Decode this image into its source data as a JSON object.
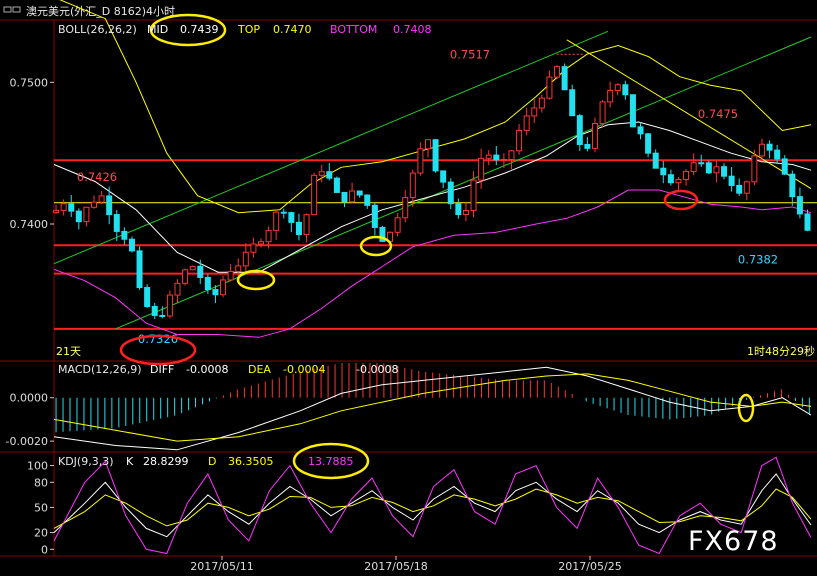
{
  "window": {
    "title": "澳元美元(外汇_D 8162)4小时"
  },
  "colors": {
    "background": "#000000",
    "up_candle": "#ff3333",
    "down_candle": "#22e0f0",
    "mid": "#ffffff",
    "top_band": "#ffff00",
    "bottom_band": "#ff33ff",
    "channel": "#22cc22",
    "hline": "#ff2020",
    "annotation": "#ffee00",
    "label_red": "#ff4b4b",
    "label_cyan": "#33d6ff",
    "bar_text": "#ffff66"
  },
  "boll": {
    "header": "BOLL(26,26,2)",
    "mid_label": "MID",
    "mid_value": "0.7439",
    "top_label": "TOP",
    "top_value": "0.7470",
    "bottom_label": "BOTTOM",
    "bottom_value": "0.7408"
  },
  "price_axis": {
    "ticks": [
      "0.7500",
      "0.7400"
    ],
    "tick_values": [
      0.75,
      0.74
    ],
    "ymin": 0.7316,
    "ymax": 0.7544
  },
  "price_labels": [
    {
      "text": "0.7426",
      "color": "red"
    },
    {
      "text": "0.7326",
      "color": "cyan"
    },
    {
      "text": "0.7517",
      "color": "red"
    },
    {
      "text": "0.7475",
      "color": "red"
    },
    {
      "text": "0.7382",
      "color": "cyan"
    }
  ],
  "status": {
    "left": "21天",
    "right": "1时48分29秒"
  },
  "macd": {
    "header": "MACD(12,26,9)",
    "diff_label": "DIFF",
    "diff_value": "-0.0008",
    "dea_label": "DEA",
    "dea_value": "-0.0004",
    "macd_value": "-0.0008",
    "ticks": [
      "0.0000",
      "-0.0020"
    ],
    "tick_values": [
      0.0,
      -0.002
    ],
    "ymin": -0.0025,
    "ymax": 0.0016
  },
  "kdj": {
    "header": "KDJ(9,3,3)",
    "k_label": "K",
    "k_value": "28.8299",
    "d_label": "D",
    "d_value": "36.3505",
    "j_value": "13.7885",
    "ticks": [
      "100",
      "80",
      "50",
      "20",
      "0"
    ],
    "tick_values": [
      100,
      80,
      50,
      20,
      0
    ],
    "ymin": -8,
    "ymax": 115
  },
  "x_axis": {
    "dates": [
      "2017/05/11",
      "2017/05/18",
      "2017/05/25"
    ]
  },
  "watermark": "FX678",
  "chart_data": {
    "type": "candlestick",
    "symbol": "澳元美元",
    "horizontal_levels": [
      0.7445,
      0.7415,
      0.7385,
      0.7365,
      0.7326
    ],
    "annotated_points": [
      {
        "label": "0.7426",
        "value": 0.7426
      },
      {
        "label": "0.7326",
        "value": 0.7326
      },
      {
        "label": "0.7517",
        "value": 0.7517
      },
      {
        "label": "0.7475",
        "value": 0.7475
      },
      {
        "label": "0.7382",
        "value": 0.7382
      }
    ],
    "close_path": [
      [
        0,
        0.7408
      ],
      [
        6,
        0.7418
      ],
      [
        12,
        0.7402
      ],
      [
        18,
        0.7416
      ],
      [
        24,
        0.742
      ],
      [
        30,
        0.7398
      ],
      [
        35,
        0.739
      ],
      [
        38,
        0.738
      ],
      [
        42,
        0.735
      ],
      [
        46,
        0.734
      ],
      [
        50,
        0.7332
      ],
      [
        54,
        0.734
      ],
      [
        58,
        0.7352
      ],
      [
        62,
        0.7362
      ],
      [
        66,
        0.7372
      ],
      [
        70,
        0.7368
      ],
      [
        74,
        0.7352
      ],
      [
        78,
        0.7348
      ],
      [
        82,
        0.736
      ],
      [
        86,
        0.7368
      ],
      [
        90,
        0.7372
      ],
      [
        94,
        0.7378
      ],
      [
        98,
        0.7386
      ],
      [
        102,
        0.7392
      ],
      [
        106,
        0.74
      ],
      [
        110,
        0.7412
      ],
      [
        114,
        0.741
      ],
      [
        118,
        0.739
      ],
      [
        122,
        0.7398
      ],
      [
        126,
        0.743
      ],
      [
        130,
        0.744
      ],
      [
        134,
        0.7432
      ],
      [
        138,
        0.742
      ],
      [
        142,
        0.7418
      ],
      [
        146,
        0.7422
      ],
      [
        150,
        0.742
      ],
      [
        154,
        0.741
      ],
      [
        158,
        0.7392
      ],
      [
        162,
        0.7388
      ],
      [
        166,
        0.74
      ],
      [
        170,
        0.7418
      ],
      [
        174,
        0.743
      ],
      [
        178,
        0.745
      ],
      [
        182,
        0.7462
      ],
      [
        186,
        0.744
      ],
      [
        190,
        0.743
      ],
      [
        194,
        0.7412
      ],
      [
        198,
        0.7402
      ],
      [
        202,
        0.7416
      ],
      [
        206,
        0.744
      ],
      [
        210,
        0.7452
      ],
      [
        214,
        0.7446
      ],
      [
        218,
        0.744
      ],
      [
        222,
        0.7448
      ],
      [
        226,
        0.7464
      ],
      [
        230,
        0.7474
      ],
      [
        234,
        0.7482
      ],
      [
        238,
        0.7492
      ],
      [
        242,
        0.7502
      ],
      [
        246,
        0.7512
      ],
      [
        250,
        0.7488
      ],
      [
        254,
        0.7466
      ],
      [
        258,
        0.745
      ],
      [
        262,
        0.746
      ],
      [
        266,
        0.748
      ],
      [
        270,
        0.7492
      ],
      [
        274,
        0.7502
      ],
      [
        278,
        0.7496
      ],
      [
        282,
        0.747
      ],
      [
        286,
        0.7462
      ],
      [
        290,
        0.7446
      ],
      [
        294,
        0.744
      ],
      [
        298,
        0.7436
      ],
      [
        302,
        0.743
      ],
      [
        306,
        0.7434
      ],
      [
        310,
        0.744
      ],
      [
        314,
        0.7442
      ],
      [
        318,
        0.7438
      ],
      [
        322,
        0.744
      ],
      [
        326,
        0.7436
      ],
      [
        330,
        0.743
      ],
      [
        334,
        0.742
      ],
      [
        338,
        0.743
      ],
      [
        342,
        0.7448
      ],
      [
        346,
        0.746
      ],
      [
        350,
        0.7452
      ],
      [
        354,
        0.744
      ],
      [
        358,
        0.743
      ],
      [
        362,
        0.7412
      ],
      [
        366,
        0.7396
      ],
      [
        369,
        0.739
      ]
    ],
    "mid_path": [
      [
        0,
        0.7442
      ],
      [
        20,
        0.743
      ],
      [
        40,
        0.741
      ],
      [
        60,
        0.738
      ],
      [
        80,
        0.7366
      ],
      [
        100,
        0.7366
      ],
      [
        120,
        0.7382
      ],
      [
        140,
        0.7398
      ],
      [
        160,
        0.741
      ],
      [
        180,
        0.7418
      ],
      [
        200,
        0.7426
      ],
      [
        220,
        0.7436
      ],
      [
        240,
        0.7448
      ],
      [
        255,
        0.7462
      ],
      [
        270,
        0.747
      ],
      [
        285,
        0.7472
      ],
      [
        300,
        0.7466
      ],
      [
        315,
        0.7458
      ],
      [
        330,
        0.745
      ],
      [
        345,
        0.7444
      ],
      [
        360,
        0.7442
      ],
      [
        369,
        0.7438
      ]
    ],
    "top_path": [
      [
        0,
        0.756
      ],
      [
        25,
        0.7545
      ],
      [
        40,
        0.75
      ],
      [
        55,
        0.745
      ],
      [
        70,
        0.742
      ],
      [
        90,
        0.7408
      ],
      [
        110,
        0.741
      ],
      [
        125,
        0.7428
      ],
      [
        140,
        0.744
      ],
      [
        160,
        0.7444
      ],
      [
        180,
        0.7452
      ],
      [
        200,
        0.746
      ],
      [
        220,
        0.7472
      ],
      [
        235,
        0.749
      ],
      [
        250,
        0.751
      ],
      [
        260,
        0.752
      ],
      [
        275,
        0.7526
      ],
      [
        290,
        0.7518
      ],
      [
        305,
        0.7504
      ],
      [
        320,
        0.7498
      ],
      [
        335,
        0.7494
      ],
      [
        345,
        0.748
      ],
      [
        355,
        0.7466
      ],
      [
        369,
        0.747
      ]
    ],
    "bottom_path": [
      [
        0,
        0.7368
      ],
      [
        15,
        0.736
      ],
      [
        30,
        0.7348
      ],
      [
        45,
        0.733
      ],
      [
        60,
        0.7322
      ],
      [
        80,
        0.7322
      ],
      [
        100,
        0.732
      ],
      [
        115,
        0.7326
      ],
      [
        130,
        0.734
      ],
      [
        145,
        0.7356
      ],
      [
        160,
        0.737
      ],
      [
        175,
        0.7384
      ],
      [
        195,
        0.7392
      ],
      [
        215,
        0.7394
      ],
      [
        235,
        0.74
      ],
      [
        250,
        0.7404
      ],
      [
        265,
        0.7412
      ],
      [
        280,
        0.7424
      ],
      [
        295,
        0.7424
      ],
      [
        305,
        0.742
      ],
      [
        320,
        0.7414
      ],
      [
        335,
        0.7412
      ],
      [
        345,
        0.741
      ],
      [
        360,
        0.7412
      ],
      [
        369,
        0.7408
      ]
    ],
    "macd_diff_path": [
      [
        0,
        -0.0018
      ],
      [
        30,
        -0.0022
      ],
      [
        60,
        -0.0024
      ],
      [
        90,
        -0.0016
      ],
      [
        120,
        -0.0006
      ],
      [
        140,
        0.0002
      ],
      [
        160,
        0.0006
      ],
      [
        180,
        0.0008
      ],
      [
        200,
        0.001
      ],
      [
        220,
        0.0012
      ],
      [
        240,
        0.0014
      ],
      [
        260,
        0.001
      ],
      [
        280,
        0.0004
      ],
      [
        300,
        -0.0002
      ],
      [
        320,
        -0.0006
      ],
      [
        340,
        -0.0004
      ],
      [
        355,
        0.0
      ],
      [
        369,
        -0.0008
      ]
    ],
    "macd_dea_path": [
      [
        0,
        -0.001
      ],
      [
        30,
        -0.0015
      ],
      [
        60,
        -0.002
      ],
      [
        90,
        -0.0018
      ],
      [
        120,
        -0.0012
      ],
      [
        140,
        -0.0006
      ],
      [
        160,
        -0.0002
      ],
      [
        180,
        0.0002
      ],
      [
        200,
        0.0005
      ],
      [
        220,
        0.0008
      ],
      [
        240,
        0.001
      ],
      [
        260,
        0.0011
      ],
      [
        280,
        0.0008
      ],
      [
        300,
        0.0003
      ],
      [
        320,
        -0.0002
      ],
      [
        340,
        -0.0004
      ],
      [
        355,
        -0.0002
      ],
      [
        369,
        -0.0004
      ]
    ],
    "kdj_k_path": [
      [
        0,
        20
      ],
      [
        15,
        55
      ],
      [
        25,
        80
      ],
      [
        35,
        50
      ],
      [
        45,
        25
      ],
      [
        55,
        15
      ],
      [
        65,
        40
      ],
      [
        75,
        65
      ],
      [
        85,
        45
      ],
      [
        95,
        30
      ],
      [
        105,
        55
      ],
      [
        115,
        75
      ],
      [
        125,
        60
      ],
      [
        135,
        40
      ],
      [
        145,
        55
      ],
      [
        155,
        70
      ],
      [
        165,
        50
      ],
      [
        175,
        35
      ],
      [
        185,
        60
      ],
      [
        195,
        75
      ],
      [
        205,
        55
      ],
      [
        215,
        45
      ],
      [
        225,
        70
      ],
      [
        235,
        80
      ],
      [
        245,
        60
      ],
      [
        255,
        45
      ],
      [
        265,
        70
      ],
      [
        275,
        55
      ],
      [
        285,
        30
      ],
      [
        295,
        20
      ],
      [
        305,
        35
      ],
      [
        315,
        45
      ],
      [
        325,
        35
      ],
      [
        335,
        30
      ],
      [
        345,
        70
      ],
      [
        352,
        90
      ],
      [
        360,
        60
      ],
      [
        369,
        29
      ]
    ],
    "kdj_d_path": [
      [
        0,
        25
      ],
      [
        15,
        45
      ],
      [
        25,
        65
      ],
      [
        35,
        55
      ],
      [
        45,
        40
      ],
      [
        55,
        28
      ],
      [
        65,
        35
      ],
      [
        75,
        55
      ],
      [
        85,
        50
      ],
      [
        95,
        40
      ],
      [
        105,
        48
      ],
      [
        115,
        63
      ],
      [
        125,
        62
      ],
      [
        135,
        50
      ],
      [
        145,
        52
      ],
      [
        155,
        62
      ],
      [
        165,
        56
      ],
      [
        175,
        45
      ],
      [
        185,
        52
      ],
      [
        195,
        65
      ],
      [
        205,
        60
      ],
      [
        215,
        52
      ],
      [
        225,
        60
      ],
      [
        235,
        72
      ],
      [
        245,
        65
      ],
      [
        255,
        55
      ],
      [
        265,
        62
      ],
      [
        275,
        58
      ],
      [
        285,
        45
      ],
      [
        295,
        32
      ],
      [
        305,
        33
      ],
      [
        315,
        40
      ],
      [
        325,
        38
      ],
      [
        335,
        34
      ],
      [
        345,
        52
      ],
      [
        352,
        72
      ],
      [
        360,
        62
      ],
      [
        369,
        36
      ]
    ],
    "kdj_j_path": [
      [
        0,
        10
      ],
      [
        15,
        80
      ],
      [
        25,
        105
      ],
      [
        35,
        40
      ],
      [
        45,
        0
      ],
      [
        55,
        -5
      ],
      [
        65,
        55
      ],
      [
        75,
        90
      ],
      [
        85,
        35
      ],
      [
        95,
        10
      ],
      [
        105,
        70
      ],
      [
        115,
        100
      ],
      [
        125,
        55
      ],
      [
        135,
        20
      ],
      [
        145,
        60
      ],
      [
        155,
        85
      ],
      [
        165,
        40
      ],
      [
        175,
        15
      ],
      [
        185,
        75
      ],
      [
        195,
        95
      ],
      [
        205,
        45
      ],
      [
        215,
        30
      ],
      [
        225,
        90
      ],
      [
        235,
        100
      ],
      [
        245,
        50
      ],
      [
        255,
        25
      ],
      [
        265,
        85
      ],
      [
        275,
        50
      ],
      [
        285,
        5
      ],
      [
        295,
        -5
      ],
      [
        305,
        40
      ],
      [
        315,
        55
      ],
      [
        325,
        30
      ],
      [
        335,
        20
      ],
      [
        345,
        100
      ],
      [
        352,
        110
      ],
      [
        360,
        55
      ],
      [
        369,
        14
      ]
    ]
  }
}
